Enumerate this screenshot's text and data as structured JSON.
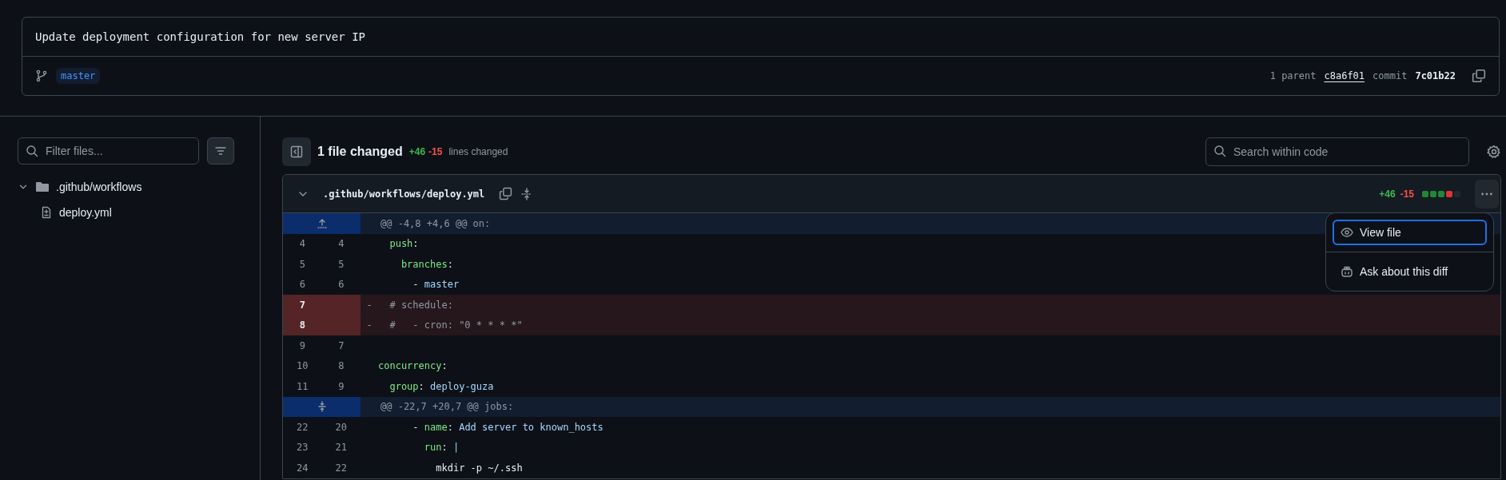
{
  "commit": {
    "message": "Update deployment configuration for new server IP",
    "branch": "master",
    "parent_label": "1 parent",
    "parent": "c8a6f01",
    "commit_label": "commit",
    "commit": "7c01b22"
  },
  "sidebar": {
    "filter": {
      "placeholder": "Filter files..."
    },
    "tree": [
      {
        "name": ".github/workflows",
        "expanded": true,
        "children": [
          {
            "name": "deploy.yml"
          }
        ]
      }
    ]
  },
  "summary": {
    "title": "1 file changed",
    "additions": "+46",
    "deletions": "-15",
    "label": "lines changed"
  },
  "search": {
    "placeholder": "Search within code"
  },
  "file": {
    "path": ".github/workflows/deploy.yml",
    "expanded": true,
    "additions": "+46",
    "deletions": "-15",
    "diffstat": [
      {
        "color": "#238636"
      },
      {
        "color": "#238636"
      },
      {
        "color": "#238636"
      },
      {
        "color": "#da3633"
      },
      {
        "color": "#212830"
      }
    ],
    "lines": [
      {
        "kind": "hunk",
        "text": "@@ -4,8 +4,6 @@ on:"
      },
      {
        "kind": "context",
        "old": "4",
        "new": "4",
        "tokens": [
          {
            "kind": "key",
            "text": "  push"
          },
          {
            "kind": "plain",
            "text": ":"
          }
        ]
      },
      {
        "kind": "context",
        "old": "5",
        "new": "5",
        "tokens": [
          {
            "kind": "key",
            "text": "    branches"
          },
          {
            "kind": "plain",
            "text": ":"
          }
        ]
      },
      {
        "kind": "context",
        "old": "6",
        "new": "6",
        "tokens": [
          {
            "kind": "plain",
            "text": "      - "
          },
          {
            "kind": "value",
            "text": "master"
          }
        ]
      },
      {
        "kind": "deleted",
        "old": "7",
        "marker": "-",
        "tokens": [
          {
            "kind": "comment",
            "text": "  # schedule:"
          }
        ]
      },
      {
        "kind": "deleted",
        "old": "8",
        "marker": "-",
        "tokens": [
          {
            "kind": "comment",
            "text": "  #   - cron: \"0 * * * *\""
          }
        ]
      },
      {
        "kind": "context",
        "old": "9",
        "new": "7"
      },
      {
        "kind": "context",
        "old": "10",
        "new": "8",
        "tokens": [
          {
            "kind": "key",
            "text": "concurrency"
          },
          {
            "kind": "plain",
            "text": ":"
          }
        ]
      },
      {
        "kind": "context",
        "old": "11",
        "new": "9",
        "tokens": [
          {
            "kind": "key",
            "text": "  group"
          },
          {
            "kind": "plain",
            "text": ": "
          },
          {
            "kind": "value",
            "text": "deploy-guza"
          }
        ]
      },
      {
        "kind": "hunk",
        "text": "@@ -22,7 +20,7 @@ jobs:"
      },
      {
        "kind": "context",
        "old": "22",
        "new": "20",
        "tokens": [
          {
            "kind": "plain",
            "text": "      - "
          },
          {
            "kind": "key",
            "text": "name"
          },
          {
            "kind": "plain",
            "text": ": "
          },
          {
            "kind": "value",
            "text": "Add server to known_hosts"
          }
        ]
      },
      {
        "kind": "context",
        "old": "23",
        "new": "21",
        "tokens": [
          {
            "kind": "key",
            "text": "        run"
          },
          {
            "kind": "plain",
            "text": ": "
          },
          {
            "kind": "value",
            "text": "|"
          }
        ]
      },
      {
        "kind": "context",
        "old": "24",
        "new": "22",
        "tokens": [
          {
            "kind": "plain",
            "text": "          mkdir -p ~/.ssh"
          }
        ]
      }
    ]
  },
  "menu": {
    "items": [
      {
        "label": "View file",
        "focused": true
      },
      {
        "label": "Ask about this diff",
        "focused": false
      }
    ]
  }
}
